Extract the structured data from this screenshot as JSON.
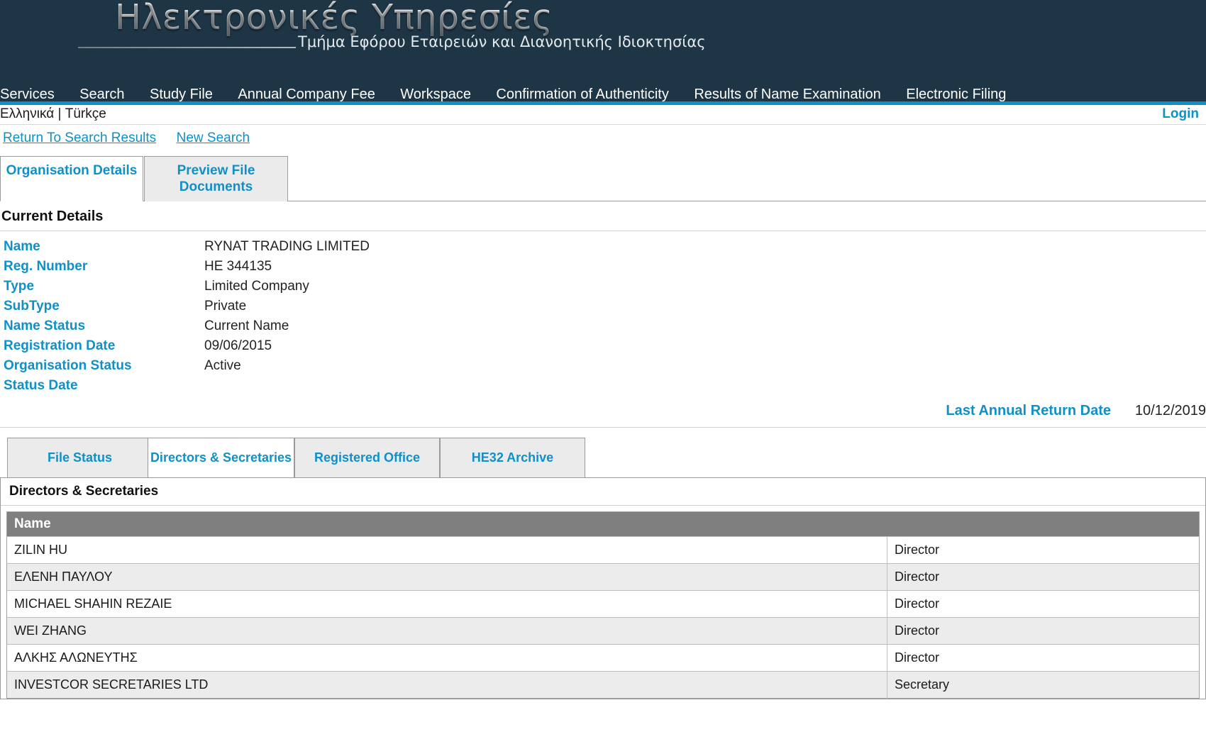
{
  "header": {
    "logo_title": "Ηλεκτρονικές Υπηρεσίες",
    "logo_subtitle": "Τμήμα Εφόρου Εταιρειών και Διανοητικής Ιδιοκτησίας",
    "background_color": "#1d3545",
    "accent_color": "#0f90c8"
  },
  "mainnav": {
    "items": [
      {
        "label": "Services"
      },
      {
        "label": "Search"
      },
      {
        "label": "Study File"
      },
      {
        "label": "Annual Company Fee"
      },
      {
        "label": "Workspace"
      },
      {
        "label": "Confirmation of Authenticity"
      },
      {
        "label": "Results of Name Examination"
      },
      {
        "label": "Electronic Filing"
      }
    ]
  },
  "langstrip": {
    "greek": "Ελληνικά",
    "separator": "|",
    "turkish": "Türkçe",
    "login": "Login"
  },
  "searchlinks": {
    "return_to_search_results": "Return To Search Results",
    "new_search": "New Search"
  },
  "toptabs": [
    {
      "label": "Organisation Details",
      "active": true
    },
    {
      "label": "Preview File Documents",
      "line1": "Preview File",
      "line2": "Documents",
      "active": false
    }
  ],
  "current_details": {
    "heading": "Current Details",
    "fields": [
      {
        "label": "Name",
        "value": "RYNAT TRADING LIMITED"
      },
      {
        "label": "Reg. Number",
        "value": "HE 344135"
      },
      {
        "label": "Type",
        "value": "Limited Company"
      },
      {
        "label": "SubType",
        "value": "Private"
      },
      {
        "label": "Name Status",
        "value": "Current Name"
      },
      {
        "label": "Registration Date",
        "value": "09/06/2015"
      },
      {
        "label": "Organisation Status",
        "value": "Active"
      },
      {
        "label": "Status Date",
        "value": ""
      }
    ],
    "last_annual_return_label": "Last Annual Return Date",
    "last_annual_return_value": "10/12/2019"
  },
  "subtabs": [
    {
      "label": "File Status",
      "active": false
    },
    {
      "label": "Directors & Secretaries",
      "active": true
    },
    {
      "label": "Registered Office",
      "active": false
    },
    {
      "label": "HE32 Archive",
      "active": false
    }
  ],
  "directors_panel": {
    "heading": "Directors & Secretaries",
    "columns": [
      "Name",
      ""
    ],
    "rows": [
      {
        "name": "ZILIN HU",
        "role": "Director"
      },
      {
        "name": "ΕΛΕΝΗ ΠΑΥΛΟΥ",
        "role": "Director"
      },
      {
        "name": "MICHAEL SHAHIN REZAIE",
        "role": "Director"
      },
      {
        "name": "WEI ZHANG",
        "role": "Director"
      },
      {
        "name": "ΑΛΚΗΣ ΑΛΩΝΕΥΤΗΣ",
        "role": "Director"
      },
      {
        "name": "INVESTCOR SECRETARIES LTD",
        "role": "Secretary"
      }
    ]
  }
}
